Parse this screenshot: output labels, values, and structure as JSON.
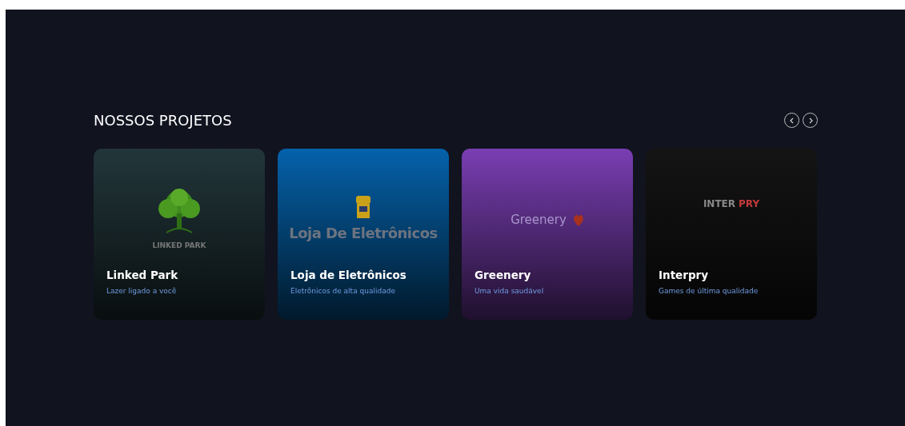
{
  "section": {
    "title": "NOSSOS PROJETOS"
  },
  "carousel_buttons": [
    {
      "kind": "prev"
    },
    {
      "kind": "next"
    }
  ],
  "projects": [
    {
      "title": "Linked Park",
      "subtitle": "Lazer ligado a você",
      "color": "#22363a",
      "logo": {
        "kind": "tree",
        "text": "LINKED PARK"
      }
    },
    {
      "title": "Loja de Eletrônicos",
      "subtitle": "Eletrônicos de alta qualidade",
      "color": "#0562ab",
      "logo": {
        "kind": "store",
        "text": "Loja De Eletrônicos"
      }
    },
    {
      "title": "Greenery",
      "subtitle": "Uma vida saudável",
      "color": "#7a3eb3",
      "logo": {
        "kind": "heart",
        "text": "Greenery"
      }
    },
    {
      "title": "Interpry",
      "subtitle": "Games de última qualidade",
      "color": "#141414",
      "logo": {
        "kind": "split",
        "text": "INTER",
        "text_2": "PRY"
      }
    }
  ]
}
